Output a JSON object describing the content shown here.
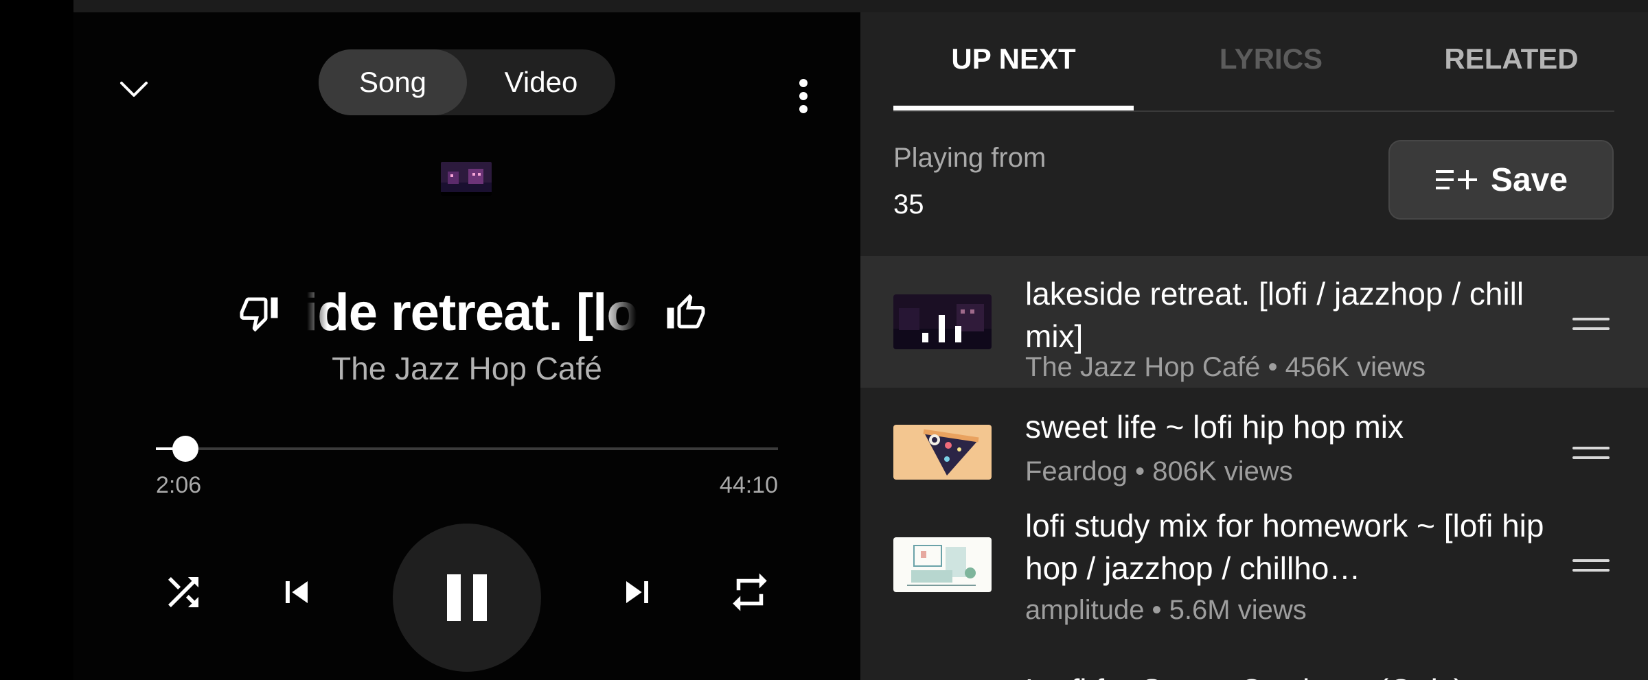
{
  "player": {
    "toggle": {
      "song_label": "Song",
      "video_label": "Video",
      "selected": "Song"
    },
    "title": "lakeside retreat. [lofi / jazzhop / chill mix]",
    "artist": "The Jazz Hop Café",
    "progress": {
      "current": "2:06",
      "total": "44:10",
      "fraction": 0.048
    },
    "state": "playing"
  },
  "queue": {
    "tabs": [
      {
        "label": "UP NEXT",
        "active": true
      },
      {
        "label": "LYRICS",
        "active": false
      },
      {
        "label": "RELATED",
        "active": false
      }
    ],
    "playing_from_label": "Playing from",
    "playing_from_value": "35",
    "save_label": "Save",
    "items": [
      {
        "title": "lakeside retreat. [lofi / jazzhop / chill mix]",
        "subtitle": "The Jazz Hop Café • 456K views",
        "active": true,
        "thumb_icon": "now-playing-bars"
      },
      {
        "title": "sweet life ~ lofi hip hop mix",
        "subtitle": "Feardog • 806K views",
        "active": false,
        "thumb_icon": "pizza-space-art"
      },
      {
        "title": "lofi study mix for homework ~ [lofi hip hop / jazzhop / chillho…",
        "subtitle": "amplitude • 5.6M views",
        "active": false,
        "thumb_icon": "room-sketch-art"
      },
      {
        "title": "Lo-fi for Space Cowboys (Only)",
        "subtitle": "",
        "active": false,
        "thumb_icon": ""
      }
    ]
  },
  "colors": {
    "background": "#030303",
    "panel": "#212121",
    "active_row": "#2e2e2e",
    "text_secondary": "#aaaaaa"
  }
}
